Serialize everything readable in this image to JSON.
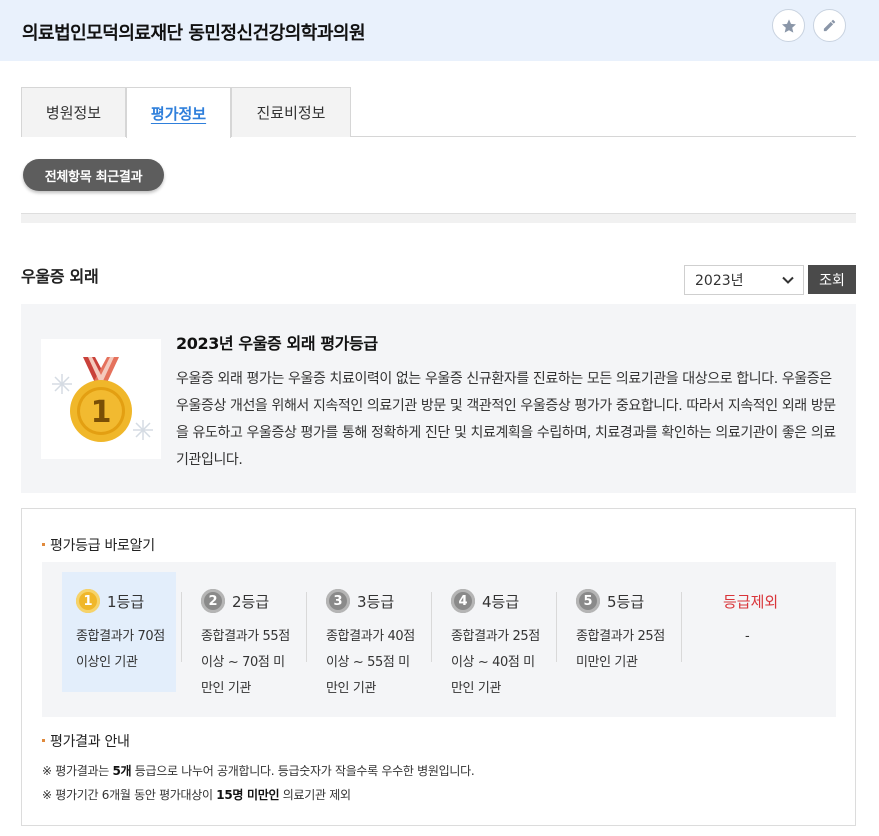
{
  "header": {
    "title": "의료법인모덕의료재단 동민정신건강의학과의원",
    "favorite_icon": "star-icon",
    "edit_icon": "pencil-icon"
  },
  "tabs": [
    {
      "label": "병원정보"
    },
    {
      "label": "평가정보"
    },
    {
      "label": "진료비정보"
    }
  ],
  "filter_pill": "전체항목 최근결과",
  "section": {
    "title": "우울증 외래",
    "year_select": "2023년",
    "search_button": "조회"
  },
  "info": {
    "title": "2023년 우울증 외래 평가등급",
    "description": "우울증 외래 평가는 우울증 치료이력이 없는 우울증 신규환자를 진료하는 모든 의료기관을 대상으로 합니다. 우울증은 우울증상 개선을 위해서 지속적인 의료기관 방문 및 객관적인 우울증상 평가가 중요합니다. 따라서 지속적인 외래 방문을 유도하고 우울증상 평가를 통해 정확하게 진단 및 치료계획을 수립하며, 치료경과를 확인하는 의료기관이 좋은 의료기관입니다.",
    "medal_grade": "1",
    "medal_icon": "gold-medal-icon"
  },
  "grade_guide": {
    "title": "평가등급 바로알기",
    "grades": [
      {
        "num": "1",
        "label": "1등급",
        "desc": "종합결과가 70점 이상인 기관"
      },
      {
        "num": "2",
        "label": "2등급",
        "desc": "종합결과가 55점 이상 ~ 70점 미만인 기관"
      },
      {
        "num": "3",
        "label": "3등급",
        "desc": "종합결과가 40점 이상 ~ 55점 미만인 기관"
      },
      {
        "num": "4",
        "label": "4등급",
        "desc": "종합결과가 25점 이상 ~ 40점 미만인 기관"
      },
      {
        "num": "5",
        "label": "5등급",
        "desc": "종합결과가 25점 미만인 기관"
      }
    ],
    "excluded": {
      "label": "등급제외",
      "desc": "-"
    }
  },
  "result_guide": {
    "title": "평가결과 안내",
    "note1_pre": "※ 평가결과는 ",
    "note1_bold": "5개",
    "note1_post": " 등급으로 나누어 공개합니다. 등급숫자가 작을수록 우수한 병원입니다.",
    "note2_pre": "※ 평가기간 6개월 동안 평가대상이 ",
    "note2_bold": "15명 미만인",
    "note2_post": " 의료기관 제외"
  },
  "colors": {
    "header_bg": "#e9f1fc",
    "active_tab": "#2f7fdb",
    "excluded_red": "#d9353a",
    "gold": "#f0b72a"
  }
}
